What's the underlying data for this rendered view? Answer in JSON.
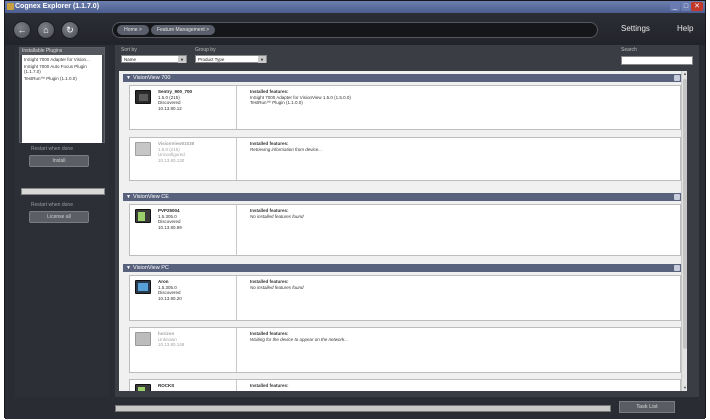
{
  "window": {
    "title": "Cognex Explorer (1.1.7.0)",
    "min": "_",
    "max": "□",
    "close": "✕"
  },
  "toolbar": {
    "back_icon": "←",
    "home_icon": "⌂",
    "refresh_icon": "↻",
    "breadcrumbs": [
      "Home >",
      "Feature Management >"
    ],
    "settings_label": "Settings",
    "help_label": "Help"
  },
  "sidebar": {
    "panel_title": "Installable Plugins",
    "plugins": [
      "InSight 7000 Adapter for Vision...",
      "InSight 7000 Auto Focus Plugin (1.1.7.0)",
      "TestRun™ Plugin (1.1.0.0)"
    ],
    "restart_note_1": "Restart when done",
    "install_button": "Install",
    "restart_note_2": "Restart when done",
    "license_button": "License all"
  },
  "filters": {
    "sort_label": "Sort by",
    "sort_value": "Name",
    "group_label": "Group by",
    "group_value": "Product Type",
    "search_label": "Search"
  },
  "groups": [
    {
      "name": "VisionView 700",
      "devices": [
        {
          "name": "Sentry_900_700",
          "version": "1.5.0 (215)",
          "status": "Discovered",
          "ip": "10.13.80.12",
          "features_title": "Installed features:",
          "features": [
            "InSight 7000 Adapter for VisionView 1.5.0 (1.5.0.0)",
            "TestRun™ Plugin (1.1.0.0)"
          ]
        },
        {
          "name": "VisionView01038",
          "version": "1.5.0 (215)",
          "status": "Unconfigured",
          "ip": "10.13.80.130",
          "features_title": "Installed features:",
          "features": [
            "Retrieving information from device..."
          ]
        }
      ]
    },
    {
      "name": "VisionView CE",
      "devices": [
        {
          "name": "PVP25004",
          "version": "1.5.305.0",
          "status": "Discovered",
          "ip": "10.13.80.99",
          "features_title": "Installed features:",
          "features": [
            "No installed features found"
          ]
        }
      ]
    },
    {
      "name": "VisionView PC",
      "devices": [
        {
          "name": "Aron",
          "version": "1.5.305.0",
          "status": "Discovered",
          "ip": "10.13.80.20",
          "features_title": "Installed features:",
          "features": [
            "No installed features found"
          ]
        },
        {
          "name": "horizon",
          "version": "",
          "status": "Unknown",
          "ip": "10.13.80.148",
          "features_title": "Installed features:",
          "features": [
            "Waiting for the device to appear on the network..."
          ]
        },
        {
          "name": "ROCKS",
          "version": "",
          "status": "",
          "ip": "",
          "features_title": "Installed features:",
          "features": []
        }
      ]
    }
  ],
  "status": {
    "task_list_label": "Task List"
  }
}
